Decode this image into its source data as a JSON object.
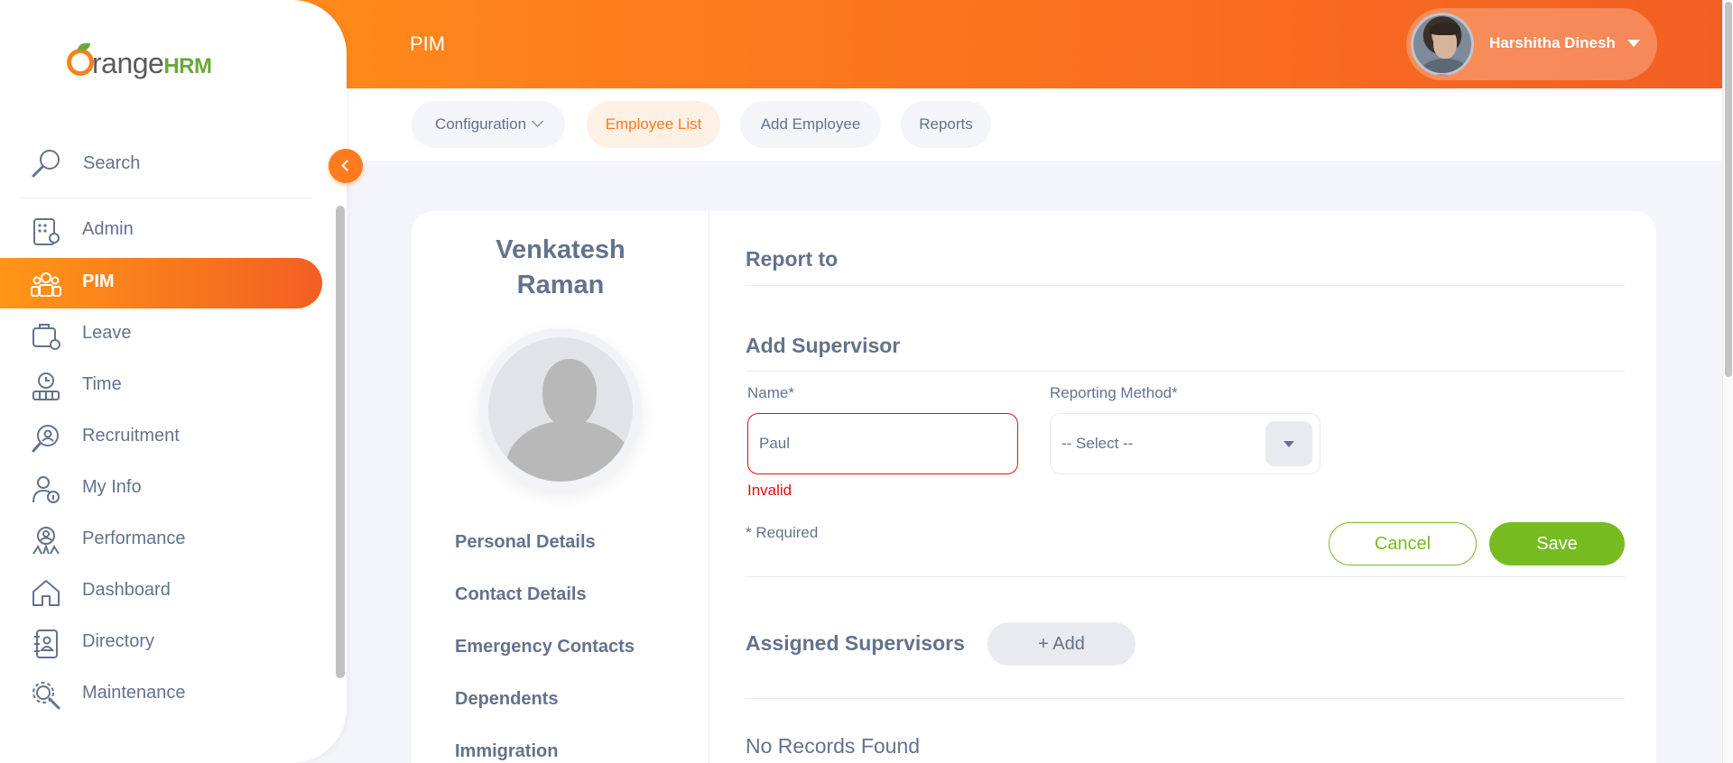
{
  "header": {
    "module_title": "PIM",
    "user_name": "Harshitha Dinesh"
  },
  "subnav": {
    "items": [
      {
        "label": "Configuration",
        "has_dropdown": true,
        "active": false
      },
      {
        "label": "Employee List",
        "active": true
      },
      {
        "label": "Add Employee",
        "active": false
      },
      {
        "label": "Reports",
        "active": false
      }
    ]
  },
  "sidebar": {
    "logo_text": "range",
    "logo_hrm": "HRM",
    "search_label": "Search",
    "items": [
      {
        "label": "Admin",
        "icon": "admin-icon"
      },
      {
        "label": "PIM",
        "icon": "pim-icon",
        "active": true
      },
      {
        "label": "Leave",
        "icon": "leave-icon"
      },
      {
        "label": "Time",
        "icon": "time-icon"
      },
      {
        "label": "Recruitment",
        "icon": "recruitment-icon"
      },
      {
        "label": "My Info",
        "icon": "myinfo-icon"
      },
      {
        "label": "Performance",
        "icon": "performance-icon"
      },
      {
        "label": "Dashboard",
        "icon": "dashboard-icon"
      },
      {
        "label": "Directory",
        "icon": "directory-icon"
      },
      {
        "label": "Maintenance",
        "icon": "maintenance-icon"
      }
    ]
  },
  "employee": {
    "first_name": "Venkatesh",
    "last_name": "Raman",
    "links": [
      "Personal Details",
      "Contact Details",
      "Emergency Contacts",
      "Dependents",
      "Immigration"
    ]
  },
  "report_to": {
    "title": "Report to",
    "add_supervisor_title": "Add Supervisor",
    "name_label": "Name*",
    "name_value": "Paul",
    "name_error": "Invalid",
    "reporting_method_label": "Reporting Method*",
    "reporting_method_value": "-- Select --",
    "required_note": "* Required",
    "cancel_label": "Cancel",
    "save_label": "Save",
    "assigned_title": "Assigned Supervisors",
    "add_label": "+ Add",
    "no_records": "No Records Found"
  },
  "colors": {
    "accent": "#ff7b1d",
    "accent_light": "#fef0e4",
    "success": "#76bc21",
    "error": "#eb0910",
    "text": "#64728c"
  }
}
